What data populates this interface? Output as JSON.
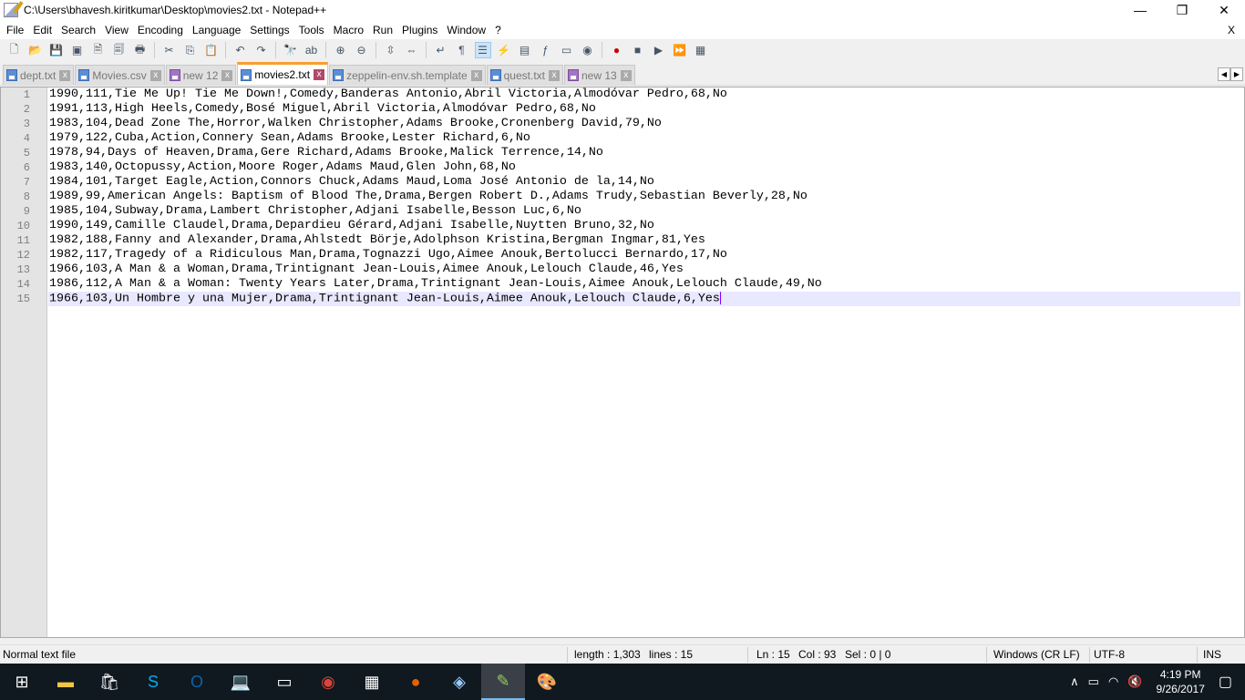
{
  "window": {
    "title": "C:\\Users\\bhavesh.kiritkumar\\Desktop\\movies2.txt - Notepad++",
    "minimize": "—",
    "maximize": "❐",
    "close": "✕"
  },
  "menu": [
    "File",
    "Edit",
    "Search",
    "View",
    "Encoding",
    "Language",
    "Settings",
    "Tools",
    "Macro",
    "Run",
    "Plugins",
    "Window",
    "?"
  ],
  "menu_close": "X",
  "toolbar": [
    "new-file",
    "open-file",
    "save",
    "save-all",
    "close",
    "close-all",
    "print",
    "|",
    "cut",
    "copy",
    "paste",
    "|",
    "undo",
    "redo",
    "|",
    "find",
    "replace",
    "|",
    "zoom-in",
    "zoom-out",
    "|",
    "sync-vertical",
    "sync-horizontal",
    "|",
    "word-wrap",
    "show-all-chars",
    "indent-guide",
    "user-defined-language",
    "doc-map",
    "function-list",
    "folder-as-workspace",
    "monitoring",
    "|",
    "record-macro",
    "stop-recording",
    "play-macro",
    "run-macro-multiple",
    "save-macro"
  ],
  "tabs": [
    {
      "label": "dept.txt",
      "modified": false,
      "active": false
    },
    {
      "label": "Movies.csv",
      "modified": false,
      "active": false
    },
    {
      "label": "new 12",
      "modified": true,
      "active": false
    },
    {
      "label": "movies2.txt",
      "modified": false,
      "active": true
    },
    {
      "label": "zeppelin-env.sh.template",
      "modified": false,
      "active": false
    },
    {
      "label": "quest.txt",
      "modified": false,
      "active": false
    },
    {
      "label": "new 13",
      "modified": true,
      "active": false
    }
  ],
  "tab_close": "x",
  "tab_nav": {
    "left": "◀",
    "right": "▶"
  },
  "lines": [
    "1990,111,Tie Me Up! Tie Me Down!,Comedy,Banderas Antonio,Abril Victoria,Almodóvar Pedro,68,No",
    "1991,113,High Heels,Comedy,Bosé Miguel,Abril Victoria,Almodóvar Pedro,68,No",
    "1983,104,Dead Zone The,Horror,Walken Christopher,Adams Brooke,Cronenberg David,79,No",
    "1979,122,Cuba,Action,Connery Sean,Adams Brooke,Lester Richard,6,No",
    "1978,94,Days of Heaven,Drama,Gere Richard,Adams Brooke,Malick Terrence,14,No",
    "1983,140,Octopussy,Action,Moore Roger,Adams Maud,Glen John,68,No",
    "1984,101,Target Eagle,Action,Connors Chuck,Adams Maud,Loma José Antonio de la,14,No",
    "1989,99,American Angels: Baptism of Blood The,Drama,Bergen Robert D.,Adams Trudy,Sebastian Beverly,28,No",
    "1985,104,Subway,Drama,Lambert Christopher,Adjani Isabelle,Besson Luc,6,No",
    "1990,149,Camille Claudel,Drama,Depardieu Gérard,Adjani Isabelle,Nuytten Bruno,32,No",
    "1982,188,Fanny and Alexander,Drama,Ahlstedt Börje,Adolphson Kristina,Bergman Ingmar,81,Yes",
    "1982,117,Tragedy of a Ridiculous Man,Drama,Tognazzi Ugo,Aimee Anouk,Bertolucci Bernardo,17,No",
    "1966,103,A Man & a Woman,Drama,Trintignant Jean-Louis,Aimee Anouk,Lelouch Claude,46,Yes",
    "1986,112,A Man & a Woman: Twenty Years Later,Drama,Trintignant Jean-Louis,Aimee Anouk,Lelouch Claude,49,No",
    "1966,103,Un Hombre y una Mujer,Drama,Trintignant Jean-Louis,Aimee Anouk,Lelouch Claude,6,Yes"
  ],
  "current_line": 15,
  "status": {
    "filetype": "Normal text file",
    "length": "length : 1,303",
    "lines": "lines : 15",
    "ln": "Ln : 15",
    "col": "Col : 93",
    "sel": "Sel : 0 | 0",
    "eol": "Windows (CR LF)",
    "encoding": "UTF-8",
    "mode": "INS"
  },
  "taskbar": {
    "time": "4:19 PM",
    "date": "9/26/2017"
  }
}
